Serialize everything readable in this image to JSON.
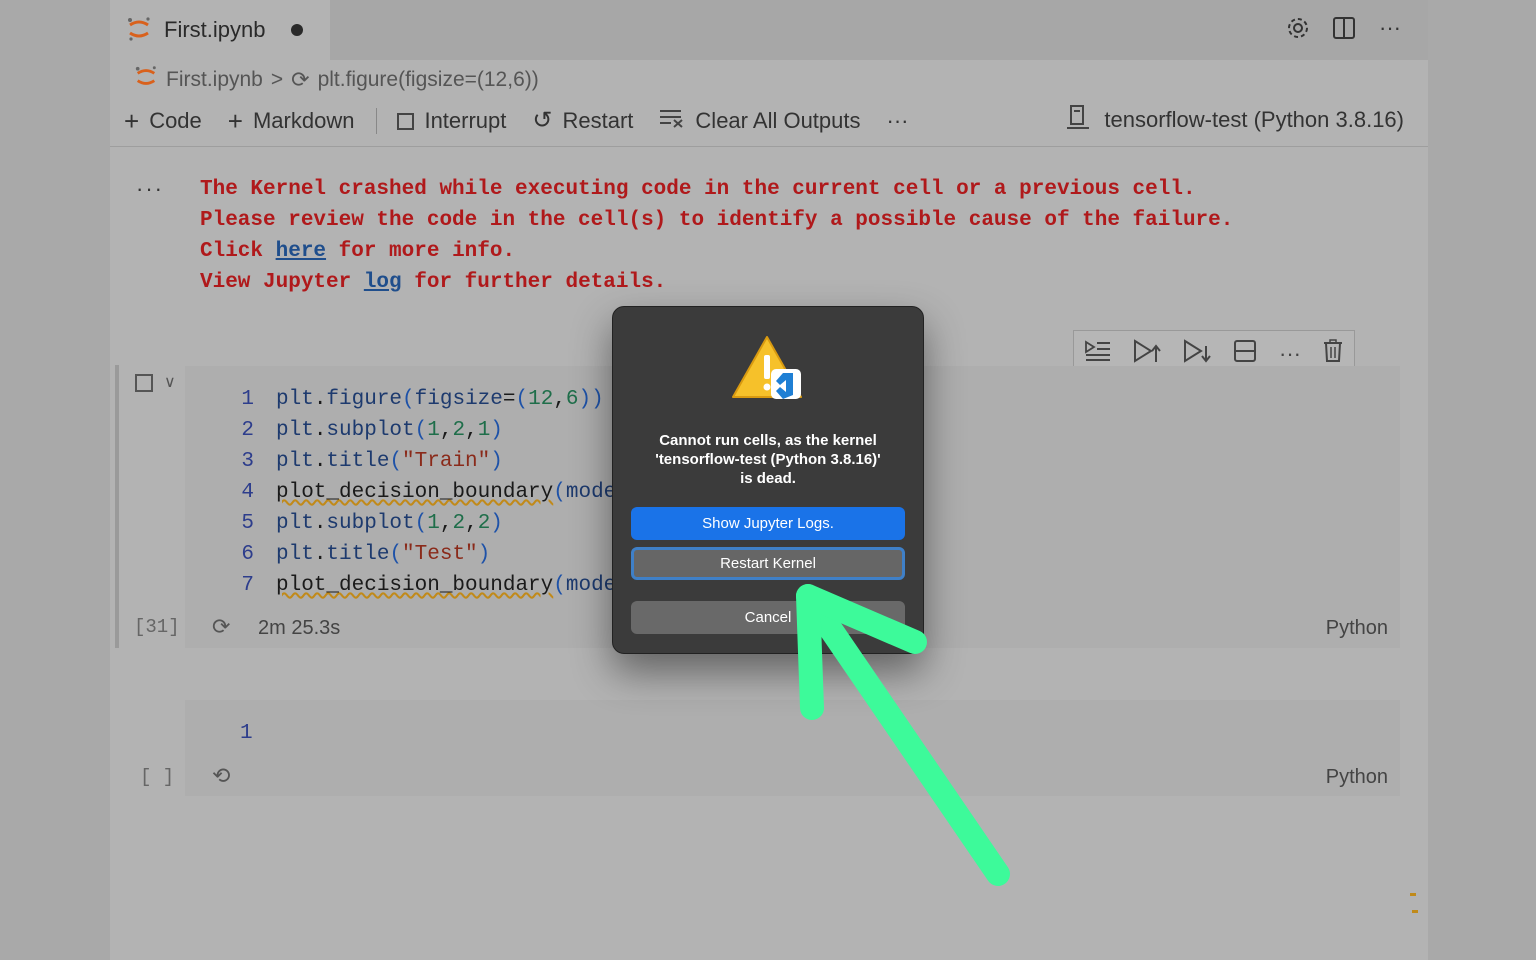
{
  "tab": {
    "title": "First.ipynb"
  },
  "breadcrumb": {
    "file": "First.ipynb",
    "separator": ">",
    "symbol": "plt.figure(figsize=(12,6))"
  },
  "toolbar": {
    "code_label": "Code",
    "markdown_label": "Markdown",
    "interrupt_label": "Interrupt",
    "restart_label": "Restart",
    "clear_label": "Clear All Outputs",
    "more_label": "···",
    "kernel_label": "tensorflow-test (Python 3.8.16)"
  },
  "output": {
    "dots": "···",
    "line1": "The Kernel crashed while executing code in the current cell or a previous cell.",
    "line2": "Please review the code in the cell(s) to identify a possible cause of the failure.",
    "line3_pre": "Click ",
    "line3_link": "here",
    "line3_post": " for more info.",
    "line4_pre": "View Jupyter ",
    "line4_link": "log",
    "line4_post": " for further details."
  },
  "cell1": {
    "lines": [
      {
        "n": "1",
        "text": "plt.figure(figsize=(12,6))"
      },
      {
        "n": "2",
        "text": "plt.subplot(1,2,1)"
      },
      {
        "n": "3",
        "text": "plt.title(\"Train\")"
      },
      {
        "n": "4",
        "text": "plot_decision_boundary(mode"
      },
      {
        "n": "5",
        "text": "plt.subplot(1,2,2)"
      },
      {
        "n": "6",
        "text": "plt.title(\"Test\")"
      },
      {
        "n": "7",
        "text": "plot_decision_boundary(mode"
      }
    ],
    "exec_count": "[31]",
    "exec_time": "2m 25.3s",
    "language": "Python"
  },
  "cell2": {
    "line_number": "1",
    "exec_count": "[ ]",
    "language": "Python"
  },
  "dialog": {
    "message_line1": "Cannot run cells, as the kernel",
    "message_line2": "'tensorflow-test (Python 3.8.16)'",
    "message_line3": "is dead.",
    "show_logs_label": "Show Jupyter Logs.",
    "restart_label": "Restart Kernel",
    "cancel_label": "Cancel"
  },
  "colors": {
    "error_text": "#b0191b",
    "primary_button": "#1a73e8",
    "arrow": "#3dfa9a"
  }
}
